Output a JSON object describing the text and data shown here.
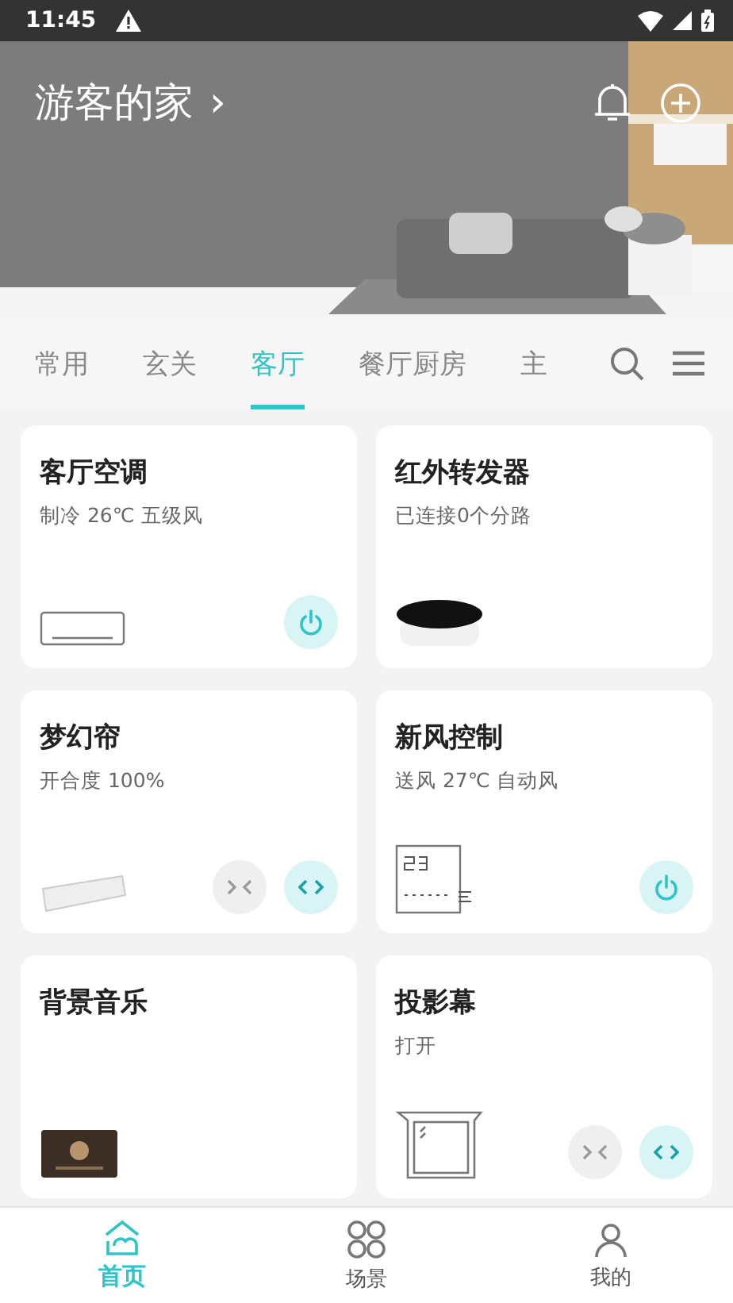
{
  "status_bar": {
    "time": "11:45"
  },
  "header": {
    "title": "游客的家",
    "chevron": "›"
  },
  "tabs": [
    {
      "label": "常用",
      "selected": false
    },
    {
      "label": "玄关",
      "selected": false
    },
    {
      "label": "客厅",
      "selected": true
    },
    {
      "label": "餐厅厨房",
      "selected": false
    },
    {
      "label": "主",
      "selected": false
    }
  ],
  "devices": [
    {
      "name": "客厅空调",
      "status": "制冷 26℃ 五级风",
      "controls": [
        {
          "kind": "power",
          "selected": true
        }
      ]
    },
    {
      "name": "红外转发器",
      "status": "已连接0个分路"
    },
    {
      "name": "梦幻帘",
      "status": "开合度 100%",
      "controls": [
        {
          "kind": "close",
          "selected": false
        },
        {
          "kind": "open",
          "selected": true
        }
      ]
    },
    {
      "name": "新风控制",
      "status": "送风 27℃ 自动风",
      "controls": [
        {
          "kind": "power",
          "selected": true
        }
      ]
    },
    {
      "name": "背景音乐"
    },
    {
      "name": "投影幕",
      "status": "打开",
      "controls": [
        {
          "kind": "close",
          "selected": false
        },
        {
          "kind": "open",
          "selected": true
        }
      ]
    }
  ],
  "bottom_nav": [
    {
      "label": "首页",
      "selected": true
    },
    {
      "label": "场景",
      "selected": false
    },
    {
      "label": "我的",
      "selected": false
    }
  ]
}
